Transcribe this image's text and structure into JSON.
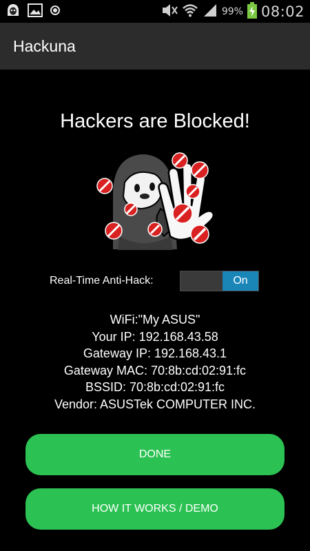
{
  "status_bar": {
    "battery_percent": "99%",
    "time": "08:02",
    "icons": [
      "hackuna-notification-icon",
      "gallery-icon",
      "record-icon",
      "mute-icon",
      "wifi-icon",
      "signal-icon",
      "battery-charging-icon"
    ]
  },
  "app_bar": {
    "title": "Hackuna"
  },
  "main": {
    "headline": "Hackers are Blocked!",
    "toggle": {
      "label": "Real-Time Anti-Hack:",
      "state": "On"
    },
    "info": {
      "wifi": "WiFi:\"My ASUS\"",
      "your_ip": "Your IP: 192.168.43.58",
      "gateway_ip": "Gateway IP: 192.168.43.1",
      "gateway_mac": "Gateway MAC: 70:8b:cd:02:91:fc",
      "bssid": "BSSID: 70:8b:cd:02:91:fc",
      "vendor": "Vendor: ASUSTek COMPUTER INC."
    },
    "buttons": {
      "done": "DONE",
      "how_it_works": "HOW IT WORKS / DEMO"
    }
  },
  "colors": {
    "accent_green": "#2cc253",
    "toggle_blue": "#1a86b8",
    "app_bar": "#2c2c2c",
    "block_red": "#d92121"
  }
}
